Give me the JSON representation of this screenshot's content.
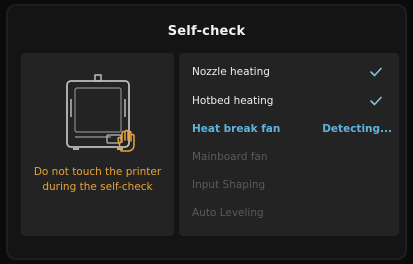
{
  "header": {
    "title": "Self-check"
  },
  "notice": {
    "line1": "Do not touch the printer",
    "line2": "during the self-check"
  },
  "icons": {
    "printer": "printer-icon",
    "hand": "hand-icon",
    "done": "checkmark-icon"
  },
  "colors": {
    "accent": "#5eb3df",
    "warning": "#e9a437",
    "done_check": "#7fc4dd",
    "pending_text": "#5a5a5a"
  },
  "checks": [
    {
      "label": "Nozzle heating",
      "state": "done"
    },
    {
      "label": "Hotbed heating",
      "state": "done"
    },
    {
      "label": "Heat break fan",
      "state": "active",
      "status": "Detecting..."
    },
    {
      "label": "Mainboard fan",
      "state": "pending"
    },
    {
      "label": "Input Shaping",
      "state": "pending"
    },
    {
      "label": "Auto Leveling",
      "state": "pending"
    }
  ]
}
